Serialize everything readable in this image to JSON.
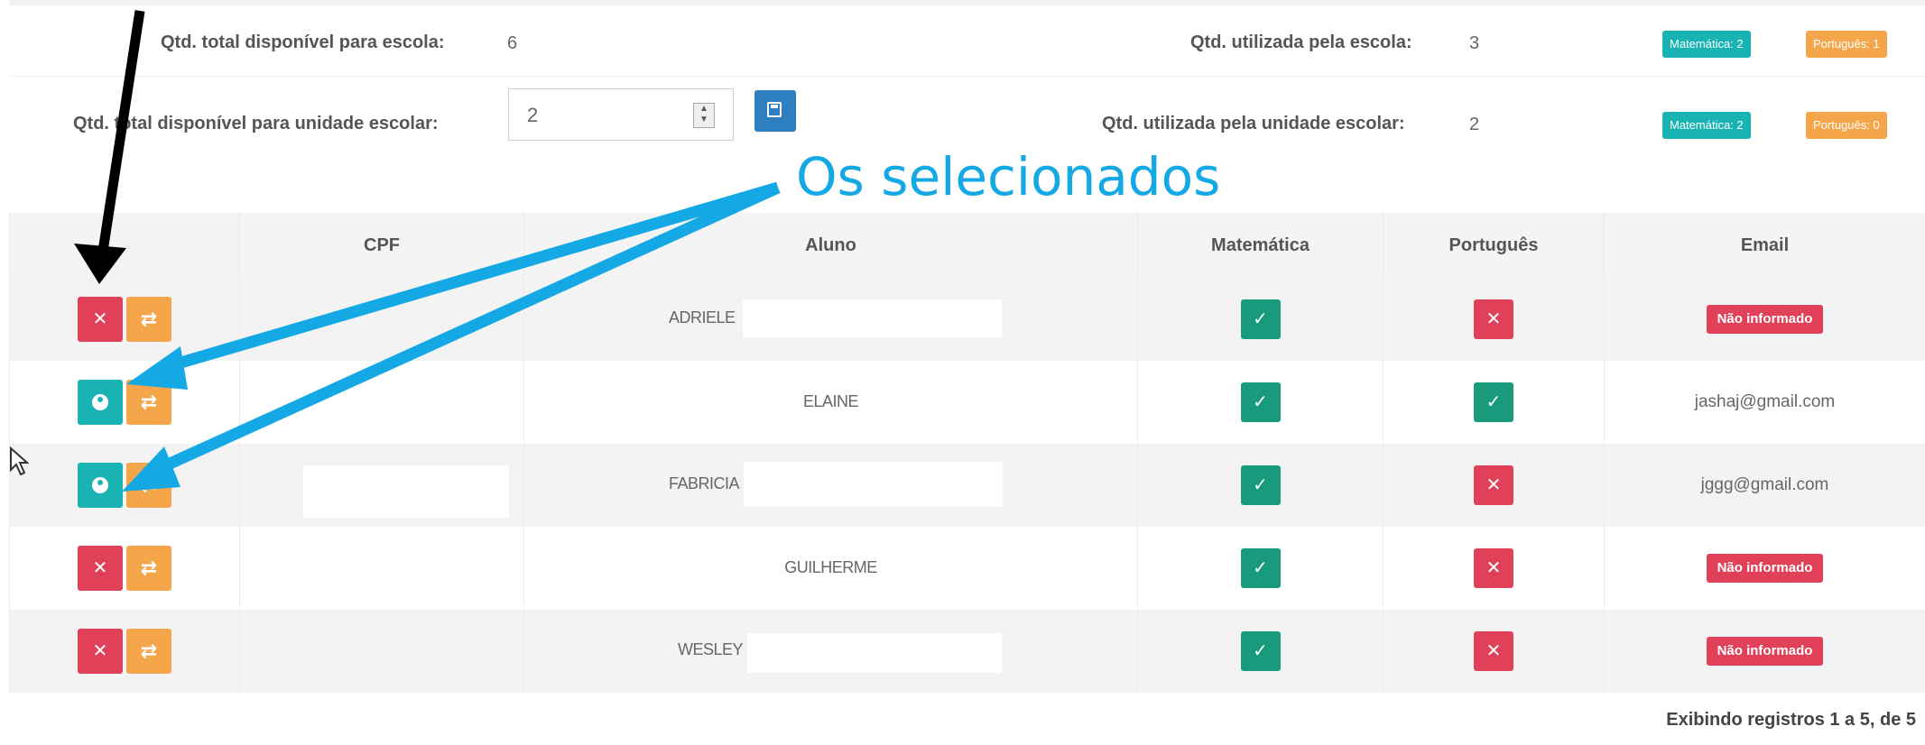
{
  "stats": {
    "school_total_label": "Qtd. total disponível para escola:",
    "school_total_value": "6",
    "school_used_label": "Qtd. utilizada pela escola:",
    "school_used_value": "3",
    "school_badges": [
      "Matemática: 2",
      "Português: 1"
    ],
    "unit_total_label": "Qtd. total disponível para unidade escolar:",
    "unit_total_value": "2",
    "unit_used_label": "Qtd. utilizada pela unidade escolar:",
    "unit_used_value": "2",
    "unit_badges": [
      "Matemática: 2",
      "Português: 0"
    ]
  },
  "annotation": "Os selecionados",
  "table": {
    "headers": [
      "",
      "CPF",
      "Aluno",
      "Matemática",
      "Português",
      "Email"
    ],
    "rows": [
      {
        "action": "remove",
        "cpf": "",
        "aluno": "ADRIELE",
        "matematica": true,
        "portugues": false,
        "email": "Não informado",
        "email_missing": true
      },
      {
        "action": "selected",
        "cpf": "",
        "aluno": "ELAINE",
        "matematica": true,
        "portugues": true,
        "email": "jashaj@gmail.com",
        "email_missing": false
      },
      {
        "action": "selected",
        "cpf": "",
        "aluno": "FABRICIA",
        "matematica": true,
        "portugues": false,
        "email": "jggg@gmail.com",
        "email_missing": false
      },
      {
        "action": "remove",
        "cpf": "",
        "aluno": "GUILHERME",
        "matematica": true,
        "portugues": false,
        "email": "Não informado",
        "email_missing": true
      },
      {
        "action": "remove",
        "cpf": "",
        "aluno": "WESLEY",
        "matematica": true,
        "portugues": false,
        "email": "Não informado",
        "email_missing": true
      }
    ]
  },
  "footer": "Exibindo registros 1 a 5, de 5",
  "icons": {
    "remove": "close-icon",
    "transfer": "swap-icon",
    "selected": "user-icon",
    "yes": "check-icon",
    "no": "close-icon",
    "save": "save-icon"
  },
  "colors": {
    "red": "#e04158",
    "orange": "#f5a54a",
    "teal": "#19b3b3",
    "green": "#1a9a7c",
    "blue": "#2d7fc1",
    "annotation": "#14a8e4"
  }
}
